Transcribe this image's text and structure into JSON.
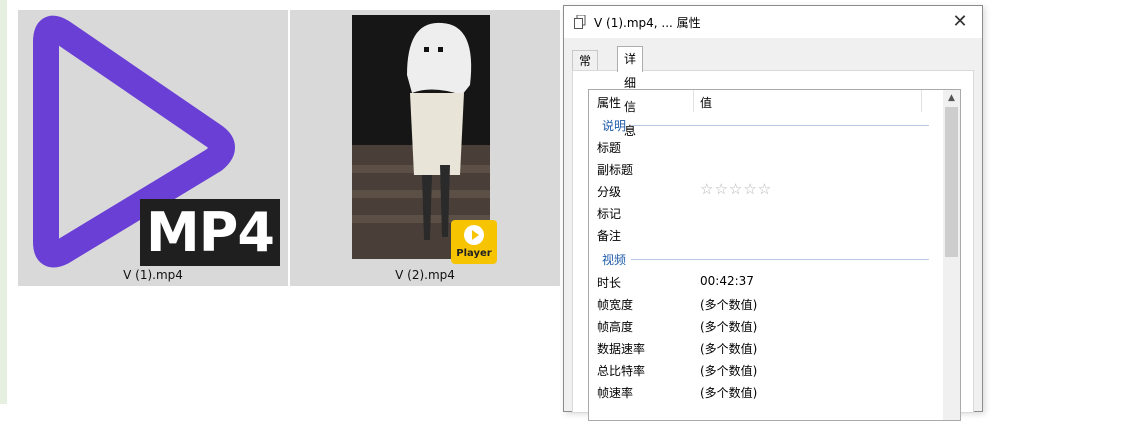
{
  "files": [
    {
      "name": "V (1).mp4",
      "icon": "mp4-file-icon",
      "badge": "MP4",
      "accent": "#6a3fd6"
    },
    {
      "name": "V (2).mp4",
      "icon": "video-thumbnail",
      "badge": "Player",
      "badge_color": "#f6c400"
    }
  ],
  "dialog": {
    "title": "V (1).mp4, ... 属性",
    "close_label": "✕",
    "tabs": [
      {
        "label": "常规"
      },
      {
        "label": "详细信息"
      }
    ],
    "active_tab": "详细信息",
    "columns": {
      "name": "属性",
      "value": "值"
    },
    "sections": [
      {
        "title": "说明",
        "rows": [
          {
            "name": "标题",
            "value": ""
          },
          {
            "name": "副标题",
            "value": ""
          },
          {
            "name": "分级",
            "value": "☆☆☆☆☆"
          },
          {
            "name": "标记",
            "value": ""
          },
          {
            "name": "备注",
            "value": ""
          }
        ]
      },
      {
        "title": "视频",
        "rows": [
          {
            "name": "时长",
            "value": "00:42:37"
          },
          {
            "name": "帧宽度",
            "value": "(多个数值)"
          },
          {
            "name": "帧高度",
            "value": "(多个数值)"
          },
          {
            "name": "数据速率",
            "value": "(多个数值)"
          },
          {
            "name": "总比特率",
            "value": "(多个数值)"
          },
          {
            "name": "帧速率",
            "value": "(多个数值)"
          }
        ]
      }
    ]
  }
}
